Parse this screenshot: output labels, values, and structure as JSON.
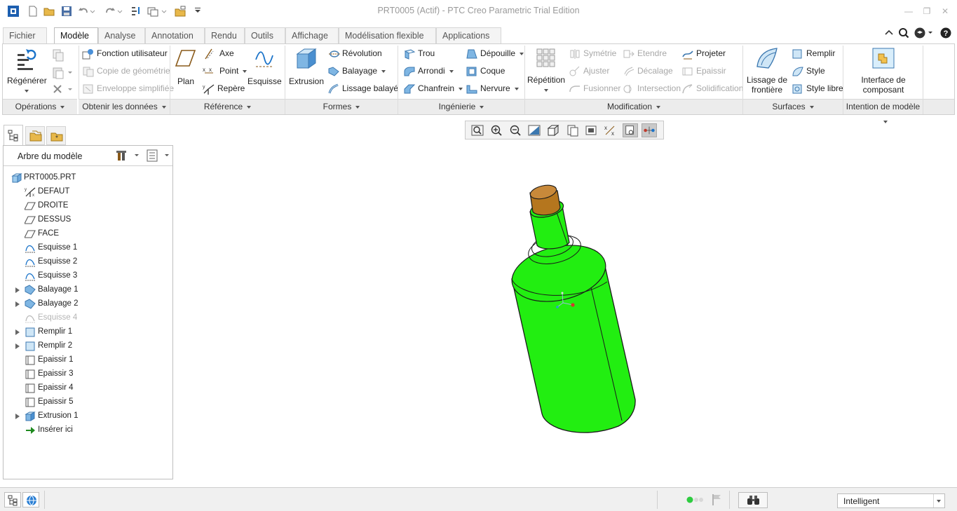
{
  "window": {
    "title": "PRT0005 (Actif) - PTC Creo Parametric Trial Edition"
  },
  "tabs": [
    {
      "label": "Fichier",
      "has_menu": true
    },
    {
      "label": "Modèle",
      "active": true
    },
    {
      "label": "Analyse"
    },
    {
      "label": "Annotation"
    },
    {
      "label": "Rendu"
    },
    {
      "label": "Outils"
    },
    {
      "label": "Affichage"
    },
    {
      "label": "Modélisation flexible"
    },
    {
      "label": "Applications"
    }
  ],
  "ribbon": {
    "operations": {
      "regenerate": "Régénérer",
      "group": "Opérations"
    },
    "data": {
      "user_feature": "Fonction utilisateur",
      "copy_geometry": "Copie de géométrie",
      "shrinkwrap": "Enveloppe simplifiée",
      "group": "Obtenir les données"
    },
    "reference": {
      "plane": "Plan",
      "axis": "Axe",
      "point": "Point",
      "csys": "Repère",
      "sketch": "Esquisse",
      "group": "Référence"
    },
    "shapes": {
      "extrude": "Extrusion",
      "revolve": "Révolution",
      "sweep": "Balayage",
      "swept_blend": "Lissage balayé",
      "group": "Formes"
    },
    "engineering": {
      "hole": "Trou",
      "round": "Arrondi",
      "chamfer": "Chanfrein",
      "draft": "Dépouille",
      "shell": "Coque",
      "rib": "Nervure",
      "group": "Ingénierie"
    },
    "modification": {
      "pattern": "Répétition",
      "mirror": "Symétrie",
      "trim": "Ajuster",
      "merge": "Fusionner",
      "extend": "Etendre",
      "offset": "Décalage",
      "intersect": "Intersection",
      "project": "Projeter",
      "thicken": "Epaissir",
      "solidify": "Solidification",
      "group": "Modification"
    },
    "surfaces": {
      "boundary_blend_1": "Lissage de",
      "boundary_blend_2": "frontière",
      "fill": "Remplir",
      "style": "Style",
      "freestyle": "Style libre",
      "group": "Surfaces"
    },
    "intent": {
      "component_interface_1": "Interface de",
      "component_interface_2": "composant",
      "group": "Intention de modèle"
    }
  },
  "tree": {
    "header": "Arbre du modèle",
    "items": [
      {
        "label": "PRT0005.PRT",
        "icon": "part-icon",
        "expandable": false,
        "level": 0
      },
      {
        "label": "DEFAUT",
        "icon": "csys-icon",
        "expandable": false,
        "level": 1
      },
      {
        "label": "DROITE",
        "icon": "datum-plane-icon",
        "expandable": false,
        "level": 1
      },
      {
        "label": "DESSUS",
        "icon": "datum-plane-icon",
        "expandable": false,
        "level": 1
      },
      {
        "label": "FACE",
        "icon": "datum-plane-icon",
        "expandable": false,
        "level": 1
      },
      {
        "label": "Esquisse 1",
        "icon": "sketch-icon",
        "expandable": false,
        "level": 1
      },
      {
        "label": "Esquisse 2",
        "icon": "sketch-icon",
        "expandable": false,
        "level": 1
      },
      {
        "label": "Esquisse 3",
        "icon": "sketch-icon",
        "expandable": false,
        "level": 1
      },
      {
        "label": "Balayage 1",
        "icon": "sweep-icon",
        "expandable": true,
        "level": 1
      },
      {
        "label": "Balayage 2",
        "icon": "sweep-icon",
        "expandable": true,
        "level": 1
      },
      {
        "label": "Esquisse 4",
        "icon": "sketch-suppressed-icon",
        "expandable": false,
        "level": 1,
        "dimmed": true
      },
      {
        "label": "Remplir 1",
        "icon": "fill-icon",
        "expandable": true,
        "level": 1
      },
      {
        "label": "Remplir 2",
        "icon": "fill-icon",
        "expandable": true,
        "level": 1
      },
      {
        "label": "Epaissir 1",
        "icon": "thicken-icon",
        "expandable": false,
        "level": 1
      },
      {
        "label": "Epaissir 3",
        "icon": "thicken-icon",
        "expandable": false,
        "level": 1
      },
      {
        "label": "Epaissir 4",
        "icon": "thicken-icon",
        "expandable": false,
        "level": 1
      },
      {
        "label": "Epaissir 5",
        "icon": "thicken-icon",
        "expandable": false,
        "level": 1
      },
      {
        "label": "Extrusion 1",
        "icon": "extrude-icon",
        "expandable": true,
        "level": 1
      },
      {
        "label": "Insérer ici",
        "icon": "insert-here-arrow-icon",
        "expandable": false,
        "level": 1
      }
    ]
  },
  "status": {
    "filter_value": "Intelligent"
  },
  "colors": {
    "model_body": "#22ee11",
    "model_cork": "#b5761e",
    "tab_active": "#ffffff"
  }
}
